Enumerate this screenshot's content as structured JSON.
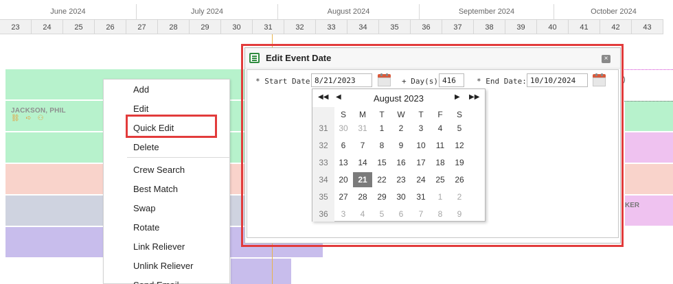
{
  "timeline": {
    "months": [
      "June 2024",
      "July 2024",
      "August 2024",
      "September 2024",
      "October 2024"
    ],
    "weeks": [
      "23",
      "24",
      "25",
      "26",
      "27",
      "28",
      "29",
      "30",
      "31",
      "32",
      "33",
      "34",
      "35",
      "36",
      "37",
      "38",
      "39",
      "40",
      "41",
      "42",
      "43"
    ]
  },
  "schedule": {
    "crew_name": "JACKSON, PHIL",
    "crew_icons": "⛓ ➪ ⚇",
    "cut_text_1": ")",
    "cut_text_2": "KER"
  },
  "context_menu": {
    "items": [
      "Add",
      "Edit",
      "Quick Edit",
      "Delete",
      "Crew Search",
      "Best Match",
      "Swap",
      "Rotate",
      "Link Reliever",
      "Unlink Reliever",
      "Send Email"
    ]
  },
  "dialog": {
    "title": "Edit Event Date",
    "close_label": "×",
    "start_label": "* Start Date:",
    "start_value": "8/21/2023",
    "days_label": "+ Day(s)",
    "days_value": "416",
    "end_label": "* End Date:",
    "end_value": "10/10/2024"
  },
  "datepicker": {
    "title": "August 2023",
    "prev_year": "◀◀",
    "prev_month": "◀",
    "next_month": "▶",
    "next_year": "▶▶",
    "weekdays": [
      "S",
      "M",
      "T",
      "W",
      "T",
      "F",
      "S"
    ],
    "weeks": [
      {
        "num": "31",
        "days": [
          "30",
          "31",
          "1",
          "2",
          "3",
          "4",
          "5"
        ]
      },
      {
        "num": "32",
        "days": [
          "6",
          "7",
          "8",
          "9",
          "10",
          "11",
          "12"
        ]
      },
      {
        "num": "33",
        "days": [
          "13",
          "14",
          "15",
          "16",
          "17",
          "18",
          "19"
        ]
      },
      {
        "num": "34",
        "days": [
          "20",
          "21",
          "22",
          "23",
          "24",
          "25",
          "26"
        ]
      },
      {
        "num": "35",
        "days": [
          "27",
          "28",
          "29",
          "30",
          "31",
          "1",
          "2"
        ]
      },
      {
        "num": "36",
        "days": [
          "3",
          "4",
          "5",
          "6",
          "7",
          "8",
          "9"
        ]
      }
    ],
    "selected": "21"
  },
  "colors": {
    "highlight_red": "#e23b3b",
    "bar_green": "#b7f2cc",
    "bar_pink": "#f9d3cb",
    "bar_slate": "#cfd3e0",
    "bar_lavender": "#c8bdec",
    "bar_magenta": "#efc2f0"
  }
}
